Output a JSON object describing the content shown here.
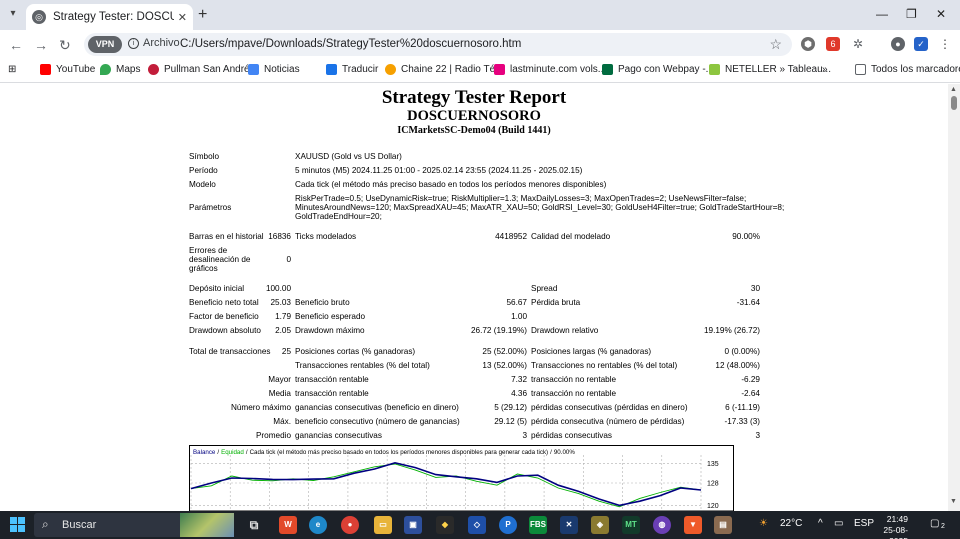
{
  "browser": {
    "tab_title": "Strategy Tester: DOSCUERNOSO",
    "new_tab_symbol": "+",
    "url_chip": "Archivo",
    "url": "C:/Users/mpave/Downloads/StrategyTester%20doscuernosoro.htm",
    "vpn_label": "VPN",
    "bookmarks": [
      "YouTube",
      "Maps",
      "Pullman San Andrés",
      "Noticias",
      "Traducir",
      "Chaine 22 | Radio Té...",
      "lastminute.com vols...",
      "Pago con Webpay -...",
      "NETELLER » Tableau...",
      "Todos los marcadores"
    ],
    "bookmark_overflow": "»"
  },
  "report": {
    "title": "Strategy Tester Report",
    "ea_name": "DOSCUERNOSORO",
    "account": "ICMarketsSC-Demo04 (Build 1441)",
    "symbol_label": "Símbolo",
    "symbol_value": "XAUUSD (Gold vs US Dollar)",
    "period_label": "Período",
    "period_value": "5 minutos (M5) 2024.11.25 01:00 - 2025.02.14 23:55 (2024.11.25 - 2025.02.15)",
    "model_label": "Modelo",
    "model_value": "Cada tick (el método más preciso basado en todos los períodos menores disponibles)",
    "params_label": "Parámetros",
    "params_lines": [
      "RiskPerTrade=0.5; UseDynamicRisk=true; RiskMultiplier=1.3; MaxDailyLosses=3; MaxOpenTrades=2; UseNewsFilter=false;",
      "MinutesAroundNews=120; MaxSpreadXAU=45; MaxATR_XAU=50; GoldRSI_Level=30; GoldUseH4Filter=true; GoldTradeStartHour=8;",
      "GoldTradeEndHour=20;"
    ],
    "bars_label": "Barras en el historial",
    "bars_value": "16836",
    "ticks_label": "Ticks modelados",
    "ticks_value": "4418952",
    "quality_label": "Calidad del modelado",
    "quality_value": "90.00%",
    "errors_label_lines": [
      "Errores de",
      "desalineación de",
      "gráficos"
    ],
    "errors_value": "0",
    "deposit_label": "Depósito inicial",
    "deposit_value": "100.00",
    "spread_label": "Spread",
    "spread_value": "30",
    "net_profit_label": "Beneficio neto total",
    "net_profit_value": "25.03",
    "gross_profit_label": "Beneficio bruto",
    "gross_profit_value": "56.67",
    "gross_loss_label": "Pérdida bruta",
    "gross_loss_value": "-31.64",
    "profit_factor_label": "Factor de beneficio",
    "profit_factor_value": "1.79",
    "expected_payoff_label": "Beneficio esperado",
    "expected_payoff_value": "1.00",
    "abs_dd_label": "Drawdown absoluto",
    "abs_dd_value": "2.05",
    "max_dd_label": "Drawdown máximo",
    "max_dd_value": "26.72 (19.19%)",
    "rel_dd_label": "Drawdown relativo",
    "rel_dd_value": "19.19% (26.72)",
    "total_trades_label": "Total de transacciones",
    "total_trades_value": "25",
    "short_label": "Posiciones cortas (% ganadoras)",
    "short_value": "25 (52.00%)",
    "long_label": "Posiciones largas (% ganadoras)",
    "long_value": "0 (0.00%)",
    "profit_trades_label": "Transacciones rentables (% del total)",
    "profit_trades_value": "13 (52.00%)",
    "loss_trades_label": "Transacciones no rentables (% del total)",
    "loss_trades_value": "12 (48.00%)",
    "largest_label": "Mayor",
    "largest_profit_label": "transacción rentable",
    "largest_profit_value": "7.32",
    "largest_loss_label": "transacción no rentable",
    "largest_loss_value": "-6.29",
    "average_label": "Media",
    "average_profit_label": "transacción rentable",
    "average_profit_value": "4.36",
    "average_loss_label": "transacción no rentable",
    "average_loss_value": "-2.64",
    "max_consec_label": "Número máximo",
    "max_consec_wins_label": "ganancias consecutivas (beneficio en dinero)",
    "max_consec_wins_value": "5 (29.12)",
    "max_consec_losses_label": "pérdidas consecutivas (pérdidas en dinero)",
    "max_consec_losses_value": "6 (-11.19)",
    "max_label": "Máx.",
    "max_consec_profit_label": "beneficio consecutivo (número de ganancias)",
    "max_consec_profit_value": "29.12 (5)",
    "max_consec_loss_label": "pérdida consecutiva (número de pérdidas)",
    "max_consec_loss_value": "-17.33 (3)",
    "avg_label": "Promedio",
    "avg_consec_wins_label": "ganancias consecutivas",
    "avg_consec_wins_value": "3",
    "avg_consec_losses_label": "pérdidas consecutivas",
    "avg_consec_losses_value": "3"
  },
  "chart_data": {
    "type": "line",
    "legend": [
      {
        "name": "Balance",
        "color": "#000080"
      },
      {
        "name": "Equidad",
        "color": "#00b000"
      },
      {
        "name": "Cada tick (el método más preciso basado en todos los períodos menores disponibles para generar cada tick)",
        "color": "#000000"
      },
      {
        "name": "90.00%",
        "color": "#000000"
      }
    ],
    "legend_separator": "/",
    "yticks": [
      135,
      128,
      120
    ],
    "ylim": [
      118,
      138
    ],
    "xlim": [
      0,
      25
    ],
    "grid": true,
    "series": [
      {
        "name": "Balance",
        "color": "#000080",
        "x": [
          0,
          1,
          2,
          3,
          4,
          5,
          6,
          7,
          8,
          9,
          10,
          11,
          12,
          13,
          14,
          15,
          16,
          17,
          18,
          19,
          20,
          21,
          22,
          23,
          24,
          25
        ],
        "y": [
          126.0,
          128.0,
          129.8,
          129.6,
          129.3,
          129.2,
          129.4,
          129.5,
          131.5,
          133.0,
          135.2,
          133.5,
          131.0,
          130.2,
          129.5,
          128.2,
          130.5,
          130.8,
          127.2,
          125.0,
          122.3,
          120.0,
          121.5,
          123.5,
          126.2,
          125.5
        ]
      },
      {
        "name": "Equidad",
        "color": "#00b000",
        "x": [
          0,
          1,
          2,
          3,
          4,
          5,
          6,
          7,
          8,
          9,
          10,
          11,
          12,
          13,
          14,
          15,
          16,
          17,
          18,
          19,
          20,
          21,
          22,
          23,
          24,
          25
        ],
        "y": [
          126.0,
          127.0,
          130.5,
          129.0,
          128.8,
          129.5,
          128.9,
          130.2,
          132.0,
          133.8,
          134.8,
          132.6,
          130.0,
          130.5,
          128.6,
          127.2,
          131.2,
          129.8,
          126.2,
          124.2,
          121.5,
          119.5,
          122.5,
          124.6,
          126.5,
          125.5
        ]
      }
    ]
  },
  "taskbar": {
    "search_label": "Buscar",
    "weather": "22°C",
    "language": "ESP",
    "time": "21:49",
    "date": "25-08-2025",
    "notifications": "2"
  }
}
